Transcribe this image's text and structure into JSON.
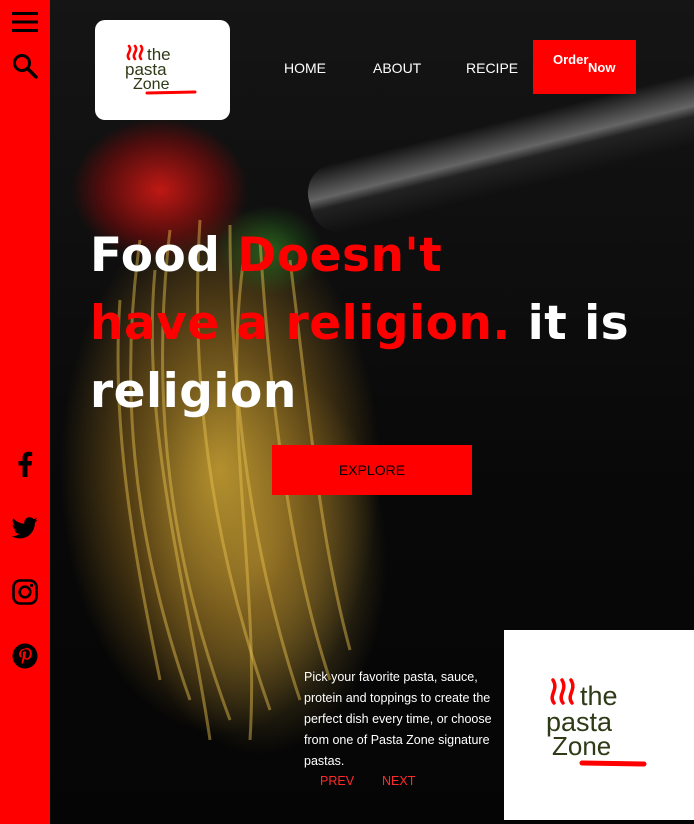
{
  "sidebar": {
    "icons": [
      "menu-icon",
      "search-icon",
      "facebook-icon",
      "twitter-icon",
      "instagram-icon",
      "pinterest-icon"
    ]
  },
  "brand": {
    "logo_line1": "the",
    "logo_line2": "pasta",
    "logo_line3": "Zone",
    "logo_color": "#2f3a17",
    "accent": "#ff0000"
  },
  "nav": {
    "home": "HOME",
    "about": "ABOUT",
    "recipe": "RECIPE",
    "order_word1": "Order",
    "order_word2": "Now"
  },
  "hero": {
    "line1_white": "Food ",
    "line1_red": "Doesn't",
    "line2_red": "have a religion.",
    "line2_white": " it is",
    "line3_white": "religion",
    "explore": "EXPLORE"
  },
  "slider": {
    "description": "Pick your favorite pasta, sauce, protein and toppings to create the perfect dish every time, or choose from one of Pasta Zone signature pastas.",
    "prev": "PREV",
    "next": "NEXT"
  }
}
